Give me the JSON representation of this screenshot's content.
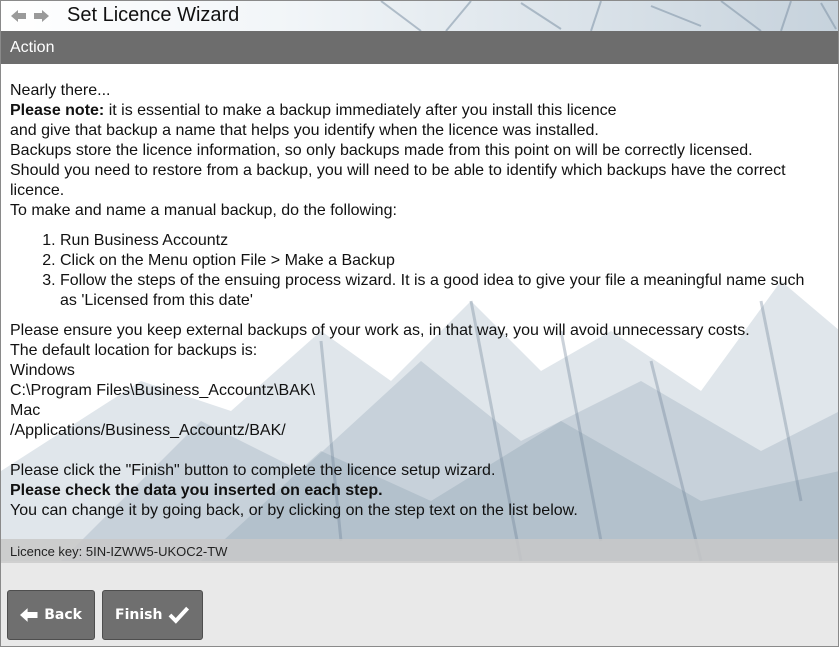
{
  "window": {
    "title": "Set Licence Wizard",
    "nav_back_icon": "arrow-left-icon",
    "nav_forward_icon": "arrow-right-icon"
  },
  "action_bar": {
    "label": "Action"
  },
  "content": {
    "line1": "Nearly there...",
    "note_bold": "Please note:",
    "note_rest": " it is essential to make a backup immediately after you install this licence",
    "line3": "and give that backup a name that helps you identify when the licence was installed.",
    "line4": "Backups store the licence information, so only backups made from this point on will be correctly licensed.",
    "line5": "Should you need to restore from a backup, you will need to be able to identify which backups have the correct licence.",
    "line6": "To make and name a manual backup, do the following:",
    "steps": [
      "Run Business Accountz",
      "Click on the Menu option File > Make a Backup",
      "Follow the steps of the ensuing process wizard. It is a good idea to give your file a meaningful name such as 'Licensed from this date'"
    ],
    "line7": "Please ensure you keep external backups of your work as, in that way, you will avoid unnecessary costs.",
    "line8": "The default location for backups is:",
    "windows_label": "Windows",
    "windows_path": "C:\\Program Files\\Business_Accountz\\BAK\\",
    "mac_label": "Mac",
    "mac_path": "/Applications/Business_Accountz/BAK/",
    "finish_note": "Please click the \"Finish\" button to complete the licence setup wizard.",
    "check_bold": "Please check the data you inserted on each step.",
    "change_note": "You can change it by going back, or by clicking on the step text on the list below."
  },
  "licence": {
    "text": "Licence key: 5IN-IZWW5-UKOC2-TW"
  },
  "buttons": {
    "back_label": "Back",
    "back_icon": "arrow-left-icon",
    "finish_label": "Finish",
    "finish_icon": "checkmark-icon"
  },
  "colors": {
    "action_bar": "#6d6d6d",
    "button": "#6f6f6f",
    "footer": "#e9e9e9"
  }
}
